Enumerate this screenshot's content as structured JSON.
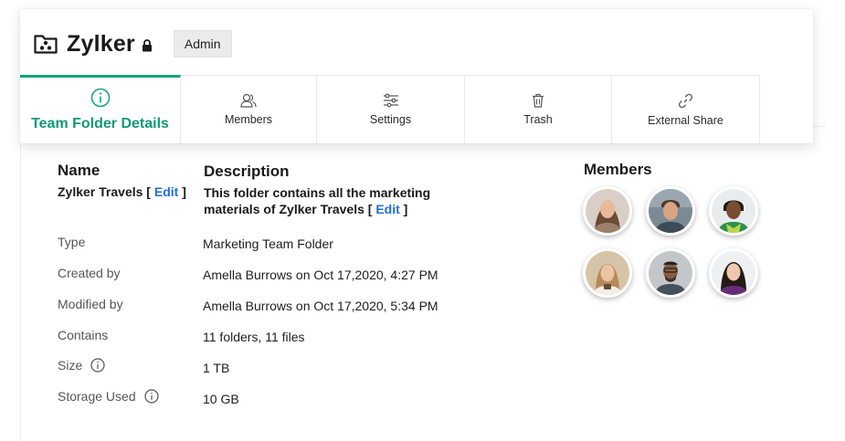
{
  "header": {
    "title": "Zylker",
    "role_badge": "Admin"
  },
  "tabs": [
    {
      "label": "Team Folder Details",
      "icon": "info-icon",
      "active": true
    },
    {
      "label": "Members",
      "icon": "users-icon"
    },
    {
      "label": "Settings",
      "icon": "sliders-icon"
    },
    {
      "label": "Trash",
      "icon": "trash-icon"
    },
    {
      "label": "External Share",
      "icon": "link-icon"
    }
  ],
  "details": {
    "name_heading": "Name",
    "name_value": "Zylker Travels",
    "description_heading": "Description",
    "description_line1": "This folder contains all the marketing",
    "description_line2": "materials of Zylker Travels",
    "edit_label": "Edit",
    "bracket_open": "[",
    "bracket_close": "]",
    "rows": [
      {
        "label": "Type",
        "value": "Marketing Team Folder"
      },
      {
        "label": "Created by",
        "value": "Amella Burrows on Oct 17,2020, 4:27 PM"
      },
      {
        "label": "Modified by",
        "value": "Amella Burrows on Oct 17,2020, 5:34 PM"
      },
      {
        "label": "Contains",
        "value": "11 folders, 11 files"
      },
      {
        "label": "Size",
        "value": "1 TB"
      },
      {
        "label": "Storage Used",
        "value": "10 GB"
      }
    ]
  },
  "members": {
    "heading": "Members",
    "count": 6
  },
  "colors": {
    "accent": "#10a37f",
    "link": "#1d6fd8"
  }
}
